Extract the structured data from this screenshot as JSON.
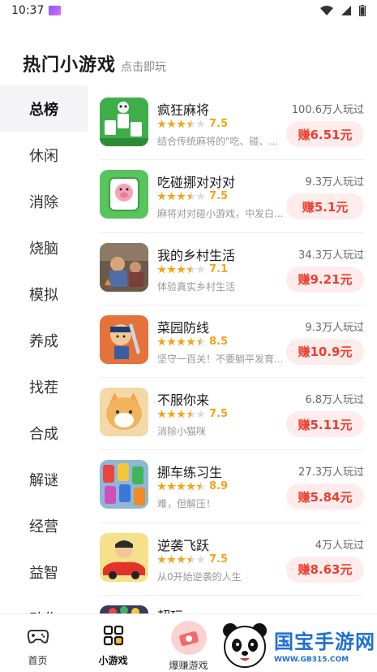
{
  "status_bar": {
    "time": "10:37"
  },
  "header": {
    "title": "热门小游戏",
    "subtitle": "点击即玩"
  },
  "sidebar": {
    "items": [
      {
        "label": "总榜",
        "active": true
      },
      {
        "label": "休闲"
      },
      {
        "label": "消除"
      },
      {
        "label": "烧脑"
      },
      {
        "label": "模拟"
      },
      {
        "label": "养成"
      },
      {
        "label": "找茬"
      },
      {
        "label": "合成"
      },
      {
        "label": "解谜"
      },
      {
        "label": "经营"
      },
      {
        "label": "益智"
      },
      {
        "label": "动作"
      }
    ]
  },
  "games": [
    {
      "name": "疯狂麻将",
      "rating": "7.5",
      "stars": 3.5,
      "desc": "结合传统麻将的\"吃、碰、...",
      "plays": "100.6万人玩过",
      "earn": "赚6.51元"
    },
    {
      "name": "吃碰挪对对对",
      "rating": "7.5",
      "stars": 3.5,
      "desc": "麻将对对碰小游戏，中发白...",
      "plays": "9.3万人玩过",
      "earn": "赚5.1元"
    },
    {
      "name": "我的乡村生活",
      "rating": "7.1",
      "stars": 3.5,
      "desc": "体验真实乡村生活",
      "plays": "34.3万人玩过",
      "earn": "赚9.21元"
    },
    {
      "name": "菜园防线",
      "rating": "8.5",
      "stars": 4.5,
      "desc": "坚守一百关！不要躺平发育...",
      "plays": "9.3万人玩过",
      "earn": "赚10.9元"
    },
    {
      "name": "不服你来",
      "rating": "7.5",
      "stars": 3.5,
      "desc": "消除小猫咪",
      "plays": "6.8万人玩过",
      "earn": "赚5.11元"
    },
    {
      "name": "挪车练习生",
      "rating": "8.9",
      "stars": 4.5,
      "desc": "难，但解压！",
      "plays": "27.3万人玩过",
      "earn": "赚5.84元"
    },
    {
      "name": "逆袭飞跃",
      "rating": "7.5",
      "stars": 3.5,
      "desc": "从0开始逆袭的人生",
      "plays": "4万人玩过",
      "earn": "赚8.63元"
    }
  ],
  "partial_game": {
    "name": "超玩一..."
  },
  "bottom_nav": [
    {
      "label": "首页"
    },
    {
      "label": "小游戏",
      "active": true
    },
    {
      "label": "爆赚游戏"
    }
  ],
  "watermark": {
    "title": "国宝手游网",
    "url": "WWW.GB315.COM"
  },
  "colors": {
    "accent_red": "#ef3d2e",
    "earn_bg": "#fdeceb",
    "star_gold": "#f2a51a",
    "sidebar_active_bg": "#f4f4f6"
  }
}
